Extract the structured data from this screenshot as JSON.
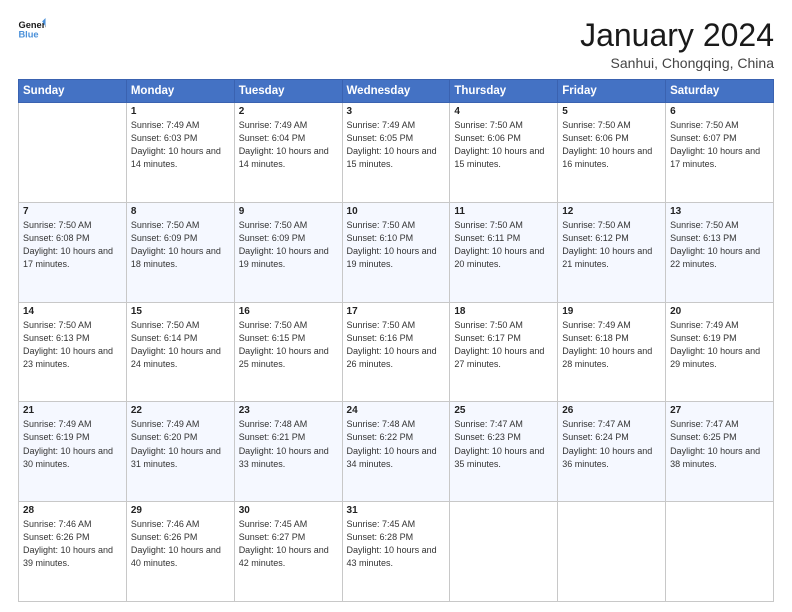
{
  "logo": {
    "line1": "General",
    "line2": "Blue"
  },
  "title": "January 2024",
  "subtitle": "Sanhui, Chongqing, China",
  "headers": [
    "Sunday",
    "Monday",
    "Tuesday",
    "Wednesday",
    "Thursday",
    "Friday",
    "Saturday"
  ],
  "weeks": [
    [
      {
        "day": "",
        "sunrise": "",
        "sunset": "",
        "daylight": ""
      },
      {
        "day": "1",
        "sunrise": "Sunrise: 7:49 AM",
        "sunset": "Sunset: 6:03 PM",
        "daylight": "Daylight: 10 hours and 14 minutes."
      },
      {
        "day": "2",
        "sunrise": "Sunrise: 7:49 AM",
        "sunset": "Sunset: 6:04 PM",
        "daylight": "Daylight: 10 hours and 14 minutes."
      },
      {
        "day": "3",
        "sunrise": "Sunrise: 7:49 AM",
        "sunset": "Sunset: 6:05 PM",
        "daylight": "Daylight: 10 hours and 15 minutes."
      },
      {
        "day": "4",
        "sunrise": "Sunrise: 7:50 AM",
        "sunset": "Sunset: 6:06 PM",
        "daylight": "Daylight: 10 hours and 15 minutes."
      },
      {
        "day": "5",
        "sunrise": "Sunrise: 7:50 AM",
        "sunset": "Sunset: 6:06 PM",
        "daylight": "Daylight: 10 hours and 16 minutes."
      },
      {
        "day": "6",
        "sunrise": "Sunrise: 7:50 AM",
        "sunset": "Sunset: 6:07 PM",
        "daylight": "Daylight: 10 hours and 17 minutes."
      }
    ],
    [
      {
        "day": "7",
        "sunrise": "Sunrise: 7:50 AM",
        "sunset": "Sunset: 6:08 PM",
        "daylight": "Daylight: 10 hours and 17 minutes."
      },
      {
        "day": "8",
        "sunrise": "Sunrise: 7:50 AM",
        "sunset": "Sunset: 6:09 PM",
        "daylight": "Daylight: 10 hours and 18 minutes."
      },
      {
        "day": "9",
        "sunrise": "Sunrise: 7:50 AM",
        "sunset": "Sunset: 6:09 PM",
        "daylight": "Daylight: 10 hours and 19 minutes."
      },
      {
        "day": "10",
        "sunrise": "Sunrise: 7:50 AM",
        "sunset": "Sunset: 6:10 PM",
        "daylight": "Daylight: 10 hours and 19 minutes."
      },
      {
        "day": "11",
        "sunrise": "Sunrise: 7:50 AM",
        "sunset": "Sunset: 6:11 PM",
        "daylight": "Daylight: 10 hours and 20 minutes."
      },
      {
        "day": "12",
        "sunrise": "Sunrise: 7:50 AM",
        "sunset": "Sunset: 6:12 PM",
        "daylight": "Daylight: 10 hours and 21 minutes."
      },
      {
        "day": "13",
        "sunrise": "Sunrise: 7:50 AM",
        "sunset": "Sunset: 6:13 PM",
        "daylight": "Daylight: 10 hours and 22 minutes."
      }
    ],
    [
      {
        "day": "14",
        "sunrise": "Sunrise: 7:50 AM",
        "sunset": "Sunset: 6:13 PM",
        "daylight": "Daylight: 10 hours and 23 minutes."
      },
      {
        "day": "15",
        "sunrise": "Sunrise: 7:50 AM",
        "sunset": "Sunset: 6:14 PM",
        "daylight": "Daylight: 10 hours and 24 minutes."
      },
      {
        "day": "16",
        "sunrise": "Sunrise: 7:50 AM",
        "sunset": "Sunset: 6:15 PM",
        "daylight": "Daylight: 10 hours and 25 minutes."
      },
      {
        "day": "17",
        "sunrise": "Sunrise: 7:50 AM",
        "sunset": "Sunset: 6:16 PM",
        "daylight": "Daylight: 10 hours and 26 minutes."
      },
      {
        "day": "18",
        "sunrise": "Sunrise: 7:50 AM",
        "sunset": "Sunset: 6:17 PM",
        "daylight": "Daylight: 10 hours and 27 minutes."
      },
      {
        "day": "19",
        "sunrise": "Sunrise: 7:49 AM",
        "sunset": "Sunset: 6:18 PM",
        "daylight": "Daylight: 10 hours and 28 minutes."
      },
      {
        "day": "20",
        "sunrise": "Sunrise: 7:49 AM",
        "sunset": "Sunset: 6:19 PM",
        "daylight": "Daylight: 10 hours and 29 minutes."
      }
    ],
    [
      {
        "day": "21",
        "sunrise": "Sunrise: 7:49 AM",
        "sunset": "Sunset: 6:19 PM",
        "daylight": "Daylight: 10 hours and 30 minutes."
      },
      {
        "day": "22",
        "sunrise": "Sunrise: 7:49 AM",
        "sunset": "Sunset: 6:20 PM",
        "daylight": "Daylight: 10 hours and 31 minutes."
      },
      {
        "day": "23",
        "sunrise": "Sunrise: 7:48 AM",
        "sunset": "Sunset: 6:21 PM",
        "daylight": "Daylight: 10 hours and 33 minutes."
      },
      {
        "day": "24",
        "sunrise": "Sunrise: 7:48 AM",
        "sunset": "Sunset: 6:22 PM",
        "daylight": "Daylight: 10 hours and 34 minutes."
      },
      {
        "day": "25",
        "sunrise": "Sunrise: 7:47 AM",
        "sunset": "Sunset: 6:23 PM",
        "daylight": "Daylight: 10 hours and 35 minutes."
      },
      {
        "day": "26",
        "sunrise": "Sunrise: 7:47 AM",
        "sunset": "Sunset: 6:24 PM",
        "daylight": "Daylight: 10 hours and 36 minutes."
      },
      {
        "day": "27",
        "sunrise": "Sunrise: 7:47 AM",
        "sunset": "Sunset: 6:25 PM",
        "daylight": "Daylight: 10 hours and 38 minutes."
      }
    ],
    [
      {
        "day": "28",
        "sunrise": "Sunrise: 7:46 AM",
        "sunset": "Sunset: 6:26 PM",
        "daylight": "Daylight: 10 hours and 39 minutes."
      },
      {
        "day": "29",
        "sunrise": "Sunrise: 7:46 AM",
        "sunset": "Sunset: 6:26 PM",
        "daylight": "Daylight: 10 hours and 40 minutes."
      },
      {
        "day": "30",
        "sunrise": "Sunrise: 7:45 AM",
        "sunset": "Sunset: 6:27 PM",
        "daylight": "Daylight: 10 hours and 42 minutes."
      },
      {
        "day": "31",
        "sunrise": "Sunrise: 7:45 AM",
        "sunset": "Sunset: 6:28 PM",
        "daylight": "Daylight: 10 hours and 43 minutes."
      },
      {
        "day": "",
        "sunrise": "",
        "sunset": "",
        "daylight": ""
      },
      {
        "day": "",
        "sunrise": "",
        "sunset": "",
        "daylight": ""
      },
      {
        "day": "",
        "sunrise": "",
        "sunset": "",
        "daylight": ""
      }
    ]
  ]
}
